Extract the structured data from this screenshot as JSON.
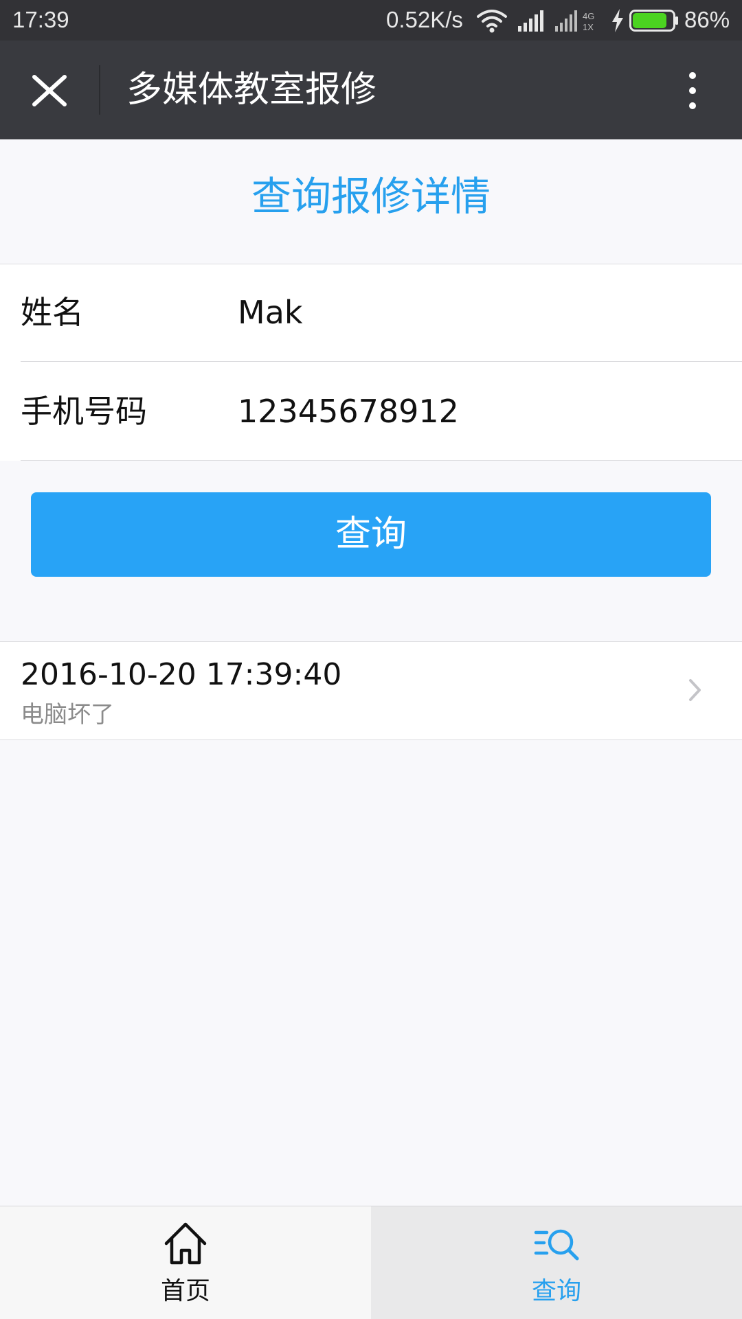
{
  "status_bar": {
    "time": "17:39",
    "network_speed": "0.52K/s",
    "network_type": "4G 1X",
    "battery_percent": "86%",
    "battery_level": 0.86,
    "icons": [
      "wifi-icon",
      "signal-icon",
      "charging-icon",
      "battery-icon"
    ]
  },
  "navbar": {
    "title": "多媒体教室报修",
    "close_icon": "close-icon",
    "more_icon": "more-vertical-icon"
  },
  "page": {
    "heading": "查询报修详情"
  },
  "form": {
    "fields": [
      {
        "label": "姓名",
        "value": "Mak"
      },
      {
        "label": "手机号码",
        "value": "12345678912"
      }
    ],
    "submit_label": "查询"
  },
  "results": [
    {
      "datetime": "2016-10-20 17:39:40",
      "description": "电脑坏了"
    }
  ],
  "tabbar": {
    "tabs": [
      {
        "label": "首页",
        "icon": "home-icon",
        "active": false
      },
      {
        "label": "查询",
        "icon": "search-list-icon",
        "active": true
      }
    ]
  },
  "colors": {
    "accent": "#27a0ee",
    "button": "#28a3f6",
    "navbar": "#393a3f",
    "status_bar": "#323236",
    "battery_fill": "#4bd320"
  }
}
